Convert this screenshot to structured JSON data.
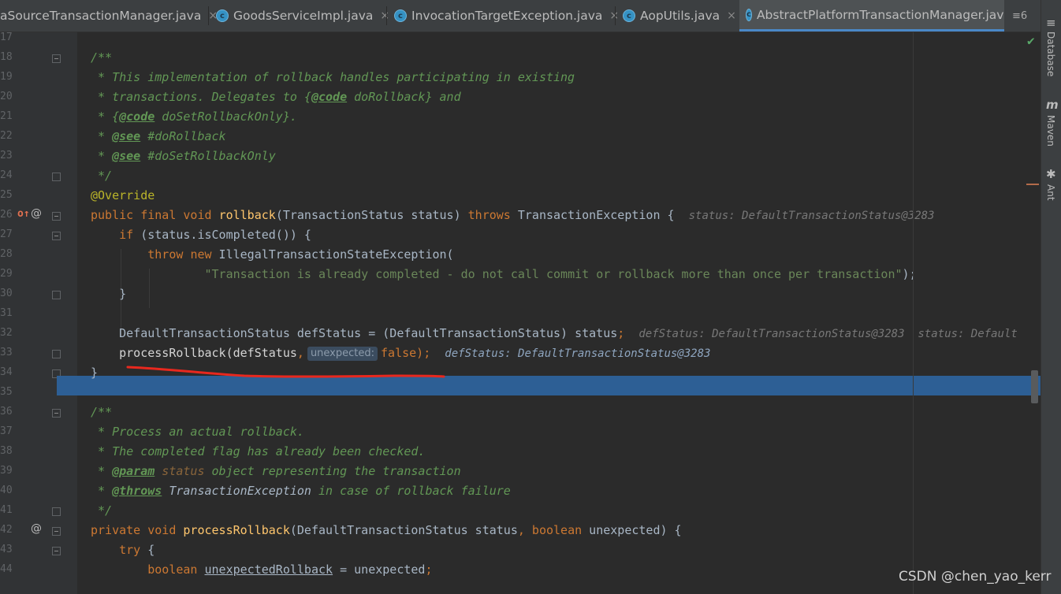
{
  "tabs": [
    {
      "label": "aSourceTransactionManager.java",
      "close": "×"
    },
    {
      "label": "GoodsServiceImpl.java",
      "close": "×"
    },
    {
      "label": "InvocationTargetException.java",
      "close": "×"
    },
    {
      "label": "AopUtils.java",
      "close": "×"
    },
    {
      "label": "AbstractPlatformTransactionManager.java"
    }
  ],
  "tab_overflow": "≡6",
  "tool_windows": [
    "Database",
    "Maven",
    "Ant"
  ],
  "line_numbers": [
    "17",
    "18",
    "19",
    "20",
    "21",
    "22",
    "23",
    "24",
    "25",
    "26",
    "27",
    "28",
    "29",
    "30",
    "31",
    "32",
    "33",
    "34",
    "35",
    "36",
    "37",
    "38",
    "39",
    "40",
    "41",
    "42",
    "43",
    "44"
  ],
  "code": {
    "l18": "/**",
    "l19": " * This implementation of rollback handles participating in existing",
    "l20a": " * transactions. Delegates to {",
    "l20tag": "@code",
    "l20b": " doRollback} and",
    "l21a": " * {",
    "l21tag": "@code",
    "l21b": " doSetRollbackOnly}.",
    "l22a": " * ",
    "l22tag": "@see",
    "l22b": " #doRollback",
    "l23a": " * ",
    "l23tag": "@see",
    "l23b": " #doSetRollbackOnly",
    "l24": " */",
    "l25": "@Override",
    "l26_kw1": "public final void ",
    "l26_fn": "rollback",
    "l26_a": "(TransactionStatus status) ",
    "l26_kw2": "throws",
    "l26_b": " TransactionException {",
    "l26_hint": "status: DefaultTransactionStatus@3283",
    "l27_kw": "if",
    "l27_a": " (status.isCompleted()) {",
    "l28_kw1": "throw",
    "l28_sp": " ",
    "l28_kw2": "new",
    "l28_a": " IllegalTransactionStateException(",
    "l29_str": "\"Transaction is already completed - do not call commit or rollback more than once per transaction\"",
    "l29_end": ");",
    "l30": "}",
    "l32_a": "DefaultTransactionStatus defStatus = (DefaultTransactionStatus) status",
    "l32_semi": ";",
    "l32_hint": "defStatus: DefaultTransactionStatus@3283  status: Default",
    "l33_a": "processRollback(defStatus",
    "l33_comma": ",",
    "l33_inlay": "unexpected:",
    "l33_kw": "false",
    "l33_end": ");",
    "l33_hint": "defStatus: DefaultTransactionStatus@3283",
    "l34": "}",
    "l36": "/**",
    "l37": " * Process an actual rollback.",
    "l38": " * The completed flag has already been checked.",
    "l39a": " * ",
    "l39tag": "@param",
    "l39p": " status",
    "l39b": " object representing the transaction",
    "l40a": " * ",
    "l40tag": "@throws",
    "l40p": " TransactionException",
    "l40b": " in case of rollback failure",
    "l41": " */",
    "l42_kw1": "private void ",
    "l42_fn": "processRollback",
    "l42_a": "(DefaultTransactionStatus status",
    "l42_comma": ", ",
    "l42_kw2": "boolean",
    "l42_b": " unexpected) {",
    "l43_kw": "try",
    "l43_a": " {",
    "l44_kw": "boolean ",
    "l44_var": "unexpectedRollback",
    "l44_a": " = unexpected",
    "l44_semi": ";"
  },
  "watermark": "CSDN @chen_yao_kerr",
  "colors": {
    "keyword": "#cc7832",
    "doc": "#629755",
    "highlight": "#2d5f95",
    "string": "#6a8759",
    "method": "#ffc66d",
    "annotation": "#bbb529",
    "underline_mark": "#e8281e"
  }
}
